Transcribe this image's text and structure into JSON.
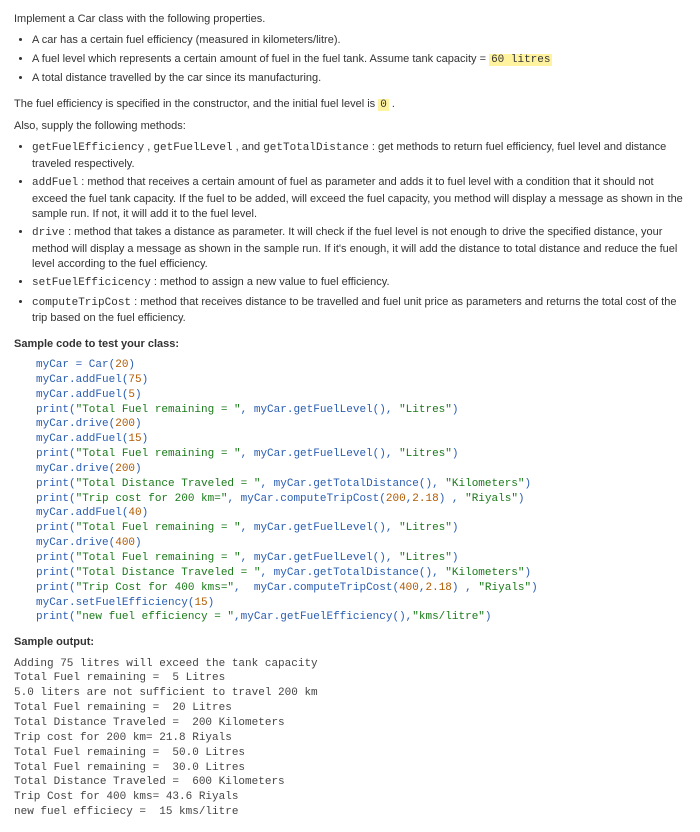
{
  "intro": "Implement a Car class with the following properties.",
  "props": [
    {
      "pre": "A car has a certain fuel efficiency (measured in kilometers/litre)."
    },
    {
      "pre": "A fuel level which represents a certain amount of fuel in the fuel tank. Assume tank capacity = ",
      "hl": "60 litres"
    },
    {
      "pre": "A total distance travelled by the car since its manufacturing."
    }
  ],
  "constructor_line": {
    "pre": "The fuel efficiency is specified in the constructor, and the initial fuel level is ",
    "hl": "0",
    "post": " ."
  },
  "methods_intro": "Also, supply the following methods:",
  "methods": [
    {
      "code1": "getFuelEfficiency",
      "txt1": " , ",
      "code2": "getFuelLevel",
      "txt2": " , and ",
      "code3": "getTotalDistance",
      "txt3": " : get methods to return fuel efficiency, fuel level and distance traveled respectively."
    },
    {
      "code1": "addFuel",
      "txt1": " : method that receives a certain amount of fuel as parameter and adds it to fuel level with a condition that it should not exceed the fuel tank capacity. If the fuel to be added, will exceed the fuel capacity, you method will display a message as shown in the sample run. If not, it will add it to the fuel level."
    },
    {
      "code1": "drive",
      "txt1": " : method that takes a distance as parameter. It will check if the fuel level is not enough to drive the specified distance, your method will display a message as shown in the sample run. If it's enough, it will add the distance to total distance and reduce the fuel level according to the fuel efficiency."
    },
    {
      "code1": "setFuelEfficicency",
      "txt1": " : method to assign a new value to fuel efficiency."
    },
    {
      "code1": "computeTripCost",
      "txt1": " : method that receives distance to be travelled and fuel unit price as parameters and returns the total cost of the trip based on the fuel efficiency."
    }
  ],
  "sample_code_label": "Sample code to test your class:",
  "sample_code_html": "myCar = Car(<span class='num'>20</span>)\nmyCar.addFuel(<span class='num'>75</span>)\nmyCar.addFuel(<span class='num'>5</span>)\nprint(<span class='str'>\"Total Fuel remaining = \"</span>, myCar.getFuelLevel(), <span class='str'>\"Litres\"</span>)\nmyCar.drive(<span class='num'>200</span>)\nmyCar.addFuel(<span class='num'>15</span>)\nprint(<span class='str'>\"Total Fuel remaining = \"</span>, myCar.getFuelLevel(), <span class='str'>\"Litres\"</span>)\nmyCar.drive(<span class='num'>200</span>)\nprint(<span class='str'>\"Total Distance Traveled = \"</span>, myCar.getTotalDistance(), <span class='str'>\"Kilometers\"</span>)\nprint(<span class='str'>\"Trip cost for 200 km=\"</span>, myCar.computeTripCost(<span class='num'>200</span>,<span class='num'>2.18</span>) , <span class='str'>\"Riyals\"</span>)\nmyCar.addFuel(<span class='num'>40</span>)\nprint(<span class='str'>\"Total Fuel remaining = \"</span>, myCar.getFuelLevel(), <span class='str'>\"Litres\"</span>)\nmyCar.drive(<span class='num'>400</span>)\nprint(<span class='str'>\"Total Fuel remaining = \"</span>, myCar.getFuelLevel(), <span class='str'>\"Litres\"</span>)\nprint(<span class='str'>\"Total Distance Traveled = \"</span>, myCar.getTotalDistance(), <span class='str'>\"Kilometers\"</span>)\nprint(<span class='str'>\"Trip Cost for 400 kms=\"</span>,  myCar.computeTripCost(<span class='num'>400</span>,<span class='num'>2.18</span>) , <span class='str'>\"Riyals\"</span>)\nmyCar.setFuelEfficiency(<span class='num'>15</span>)\nprint(<span class='str'>\"new fuel efficiency = \"</span>,myCar.getFuelEfficiency(),<span class='str'>\"kms/litre\"</span>)",
  "sample_output_label": "Sample output:",
  "sample_output": "Adding 75 litres will exceed the tank capacity\nTotal Fuel remaining =  5 Litres\n5.0 liters are not sufficient to travel 200 km\nTotal Fuel remaining =  20 Litres\nTotal Distance Traveled =  200 Kilometers\nTrip cost for 200 km= 21.8 Riyals\nTotal Fuel remaining =  50.0 Litres\nTotal Fuel remaining =  30.0 Litres\nTotal Distance Traveled =  600 Kilometers\nTrip Cost for 400 kms= 43.6 Riyals\nnew fuel efficiecy =  15 kms/litre"
}
